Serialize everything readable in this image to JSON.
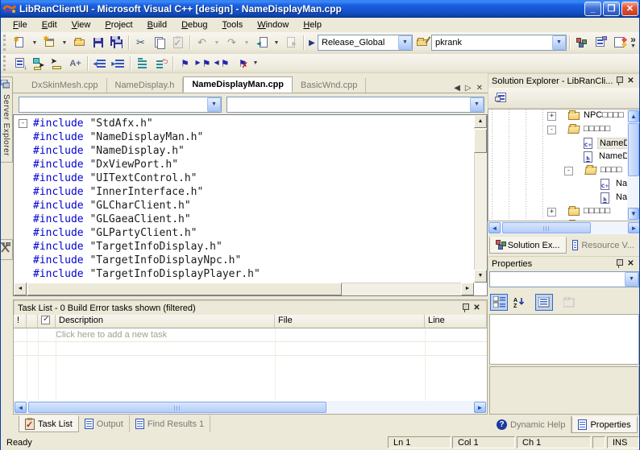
{
  "window": {
    "title": "LibRanClientUI - Microsoft Visual C++ [design] - NameDisplayMan.cpp",
    "minimize_label": "_",
    "restore_label": "❐",
    "close_label": "✕"
  },
  "menu": {
    "items": [
      "File",
      "Edit",
      "View",
      "Project",
      "Build",
      "Debug",
      "Tools",
      "Window",
      "Help"
    ]
  },
  "toolbar": {
    "build_config": "Release_Global",
    "search_value": "pkrank",
    "font_grow_label": "A+",
    "overflow_chevron": "»"
  },
  "doc_tabs": {
    "tabs": [
      {
        "label": "DxSkinMesh.cpp",
        "active": false
      },
      {
        "label": "NameDisplay.h",
        "active": false
      },
      {
        "label": "NameDisplayMan.cpp",
        "active": true
      },
      {
        "label": "BasicWnd.cpp",
        "active": false
      }
    ]
  },
  "editor": {
    "types_combo_value": "",
    "members_combo_value": "",
    "fold_glyph": "-",
    "lines": [
      {
        "directive": "#include",
        "header": "\"StdAfx.h\""
      },
      {
        "directive": "#include",
        "header": "\"NameDisplayMan.h\""
      },
      {
        "directive": "#include",
        "header": "\"NameDisplay.h\""
      },
      {
        "directive": "#include",
        "header": "\"DxViewPort.h\""
      },
      {
        "directive": "#include",
        "header": "\"UITextControl.h\""
      },
      {
        "directive": "#include",
        "header": "\"InnerInterface.h\""
      },
      {
        "directive": "#include",
        "header": "\"GLCharClient.h\""
      },
      {
        "directive": "#include",
        "header": "\"GLGaeaClient.h\""
      },
      {
        "directive": "#include",
        "header": "\"GLPartyClient.h\""
      },
      {
        "directive": "#include",
        "header": "\"TargetInfoDisplay.h\""
      },
      {
        "directive": "#include",
        "header": "\"TargetInfoDisplayNpc.h\""
      },
      {
        "directive": "#include",
        "header": "\"TargetInfoDisplayPlayer.h\""
      }
    ]
  },
  "left_strip": {
    "server_explorer_label": "Server Explorer"
  },
  "solution_explorer": {
    "title": "Solution Explorer - LibRanCli...",
    "tree": [
      {
        "type": "folder-closed",
        "toggle": "+",
        "label": "NPC□□□□",
        "level": 0,
        "selected": false
      },
      {
        "type": "folder-open",
        "toggle": "-",
        "label": "□□□□□",
        "level": 0,
        "selected": false
      },
      {
        "type": "cpp-file",
        "toggle": "",
        "label": "NameDi",
        "level": 1,
        "selected": true
      },
      {
        "type": "h-file",
        "toggle": "",
        "label": "NameDi",
        "level": 1,
        "selected": false
      },
      {
        "type": "folder-open",
        "toggle": "-",
        "label": "□□□□",
        "level": 1,
        "selected": false
      },
      {
        "type": "cpp-file",
        "toggle": "",
        "label": "Nar",
        "level": 2,
        "selected": false
      },
      {
        "type": "h-file",
        "toggle": "",
        "label": "Nar",
        "level": 2,
        "selected": false
      },
      {
        "type": "folder-closed",
        "toggle": "+",
        "label": "□□□□□",
        "level": 0,
        "selected": false
      },
      {
        "type": "folder-closed",
        "toggle": "",
        "label": "□□□□□",
        "level": 0,
        "selected": false
      }
    ],
    "tabs": [
      {
        "label": "Solution Ex...",
        "active": true,
        "icon": "solution-explorer-icon"
      },
      {
        "label": "Resource V...",
        "active": false,
        "icon": "resource-view-icon"
      }
    ]
  },
  "properties_panel": {
    "title": "Properties",
    "object_combo_value": "",
    "tabs": [
      {
        "label": "Dynamic Help",
        "active": false,
        "icon": "dynamic-help-icon"
      },
      {
        "label": "Properties",
        "active": true,
        "icon": "properties-icon"
      }
    ]
  },
  "task_list": {
    "title": "Task List - 0 Build Error tasks shown (filtered)",
    "columns": [
      "!",
      "",
      "",
      "Description",
      "File",
      "Line"
    ],
    "placeholder": "Click here to add a new task",
    "tabs": [
      {
        "label": "Task List",
        "active": true,
        "icon": "task-list-icon"
      },
      {
        "label": "Output",
        "active": false,
        "icon": "output-icon"
      },
      {
        "label": "Find Results 1",
        "active": false,
        "icon": "find-results-icon"
      }
    ]
  },
  "status_bar": {
    "ready": "Ready",
    "line": "Ln 1",
    "column": "Col 1",
    "character": "Ch 1",
    "mode": "INS"
  },
  "colors": {
    "titlebar_blue": "#1A5FE0",
    "chrome_tan": "#ECE9D8",
    "keyword_blue": "#0000D4",
    "close_red": "#D0492C",
    "xp_scrollbar_blue": "#BCD4FB",
    "inactive_tab_text": "#7A7A72"
  }
}
